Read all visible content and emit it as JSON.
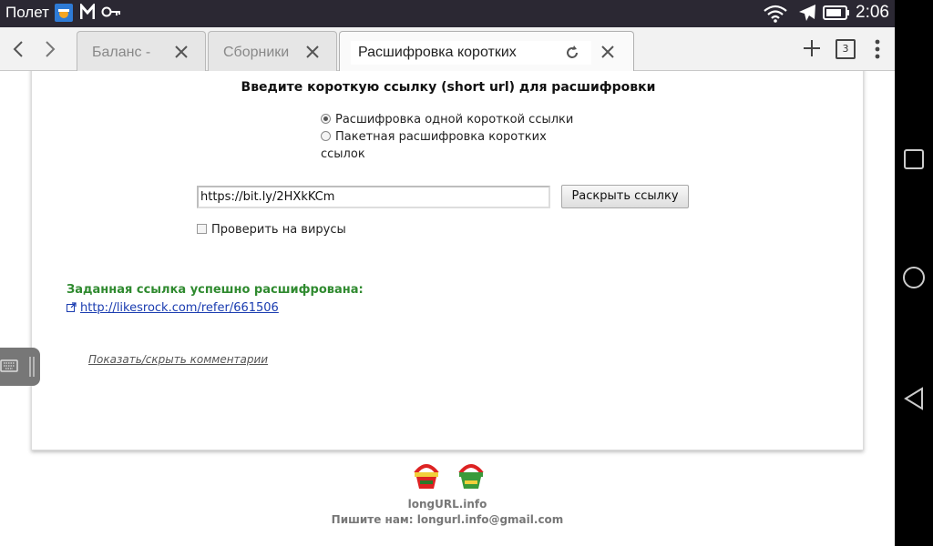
{
  "status_bar": {
    "carrier": "Полет",
    "clock": "2:06",
    "icons": [
      "app-notification-icon",
      "m-icon",
      "key-icon",
      "wifi-icon",
      "airplane-icon",
      "battery-icon"
    ]
  },
  "browser": {
    "tabs": [
      {
        "title": "Баланс -",
        "active": false
      },
      {
        "title": "Сборники",
        "active": false
      },
      {
        "title": "Расшифровка коротких",
        "active": true
      }
    ],
    "tab_count": "3"
  },
  "form": {
    "heading": "Введите короткую ссылку (short url) для расшифровки",
    "radio_single": "Расшифровка одной короткой ссылки",
    "radio_batch_line1": "Пакетная расшифровка коротких",
    "radio_batch_line2": "ссылок",
    "url_value": "https://bit.ly/2HXkKCm",
    "expand_button": "Раскрыть ссылку",
    "virus_check": "Проверить на вирусы"
  },
  "result": {
    "title": "Заданная ссылка успешно расшифрована:",
    "link": "http://likesrock.com/refer/661506"
  },
  "comments_toggle": "Показать/скрыть комментарии",
  "footer": {
    "site": "longURL.info",
    "contact": "Пишите нам: longurl.info@gmail.com"
  },
  "colors": {
    "status_bar": "#2b2833",
    "success_green": "#2f8a2f",
    "link_blue": "#1a3cb0"
  }
}
